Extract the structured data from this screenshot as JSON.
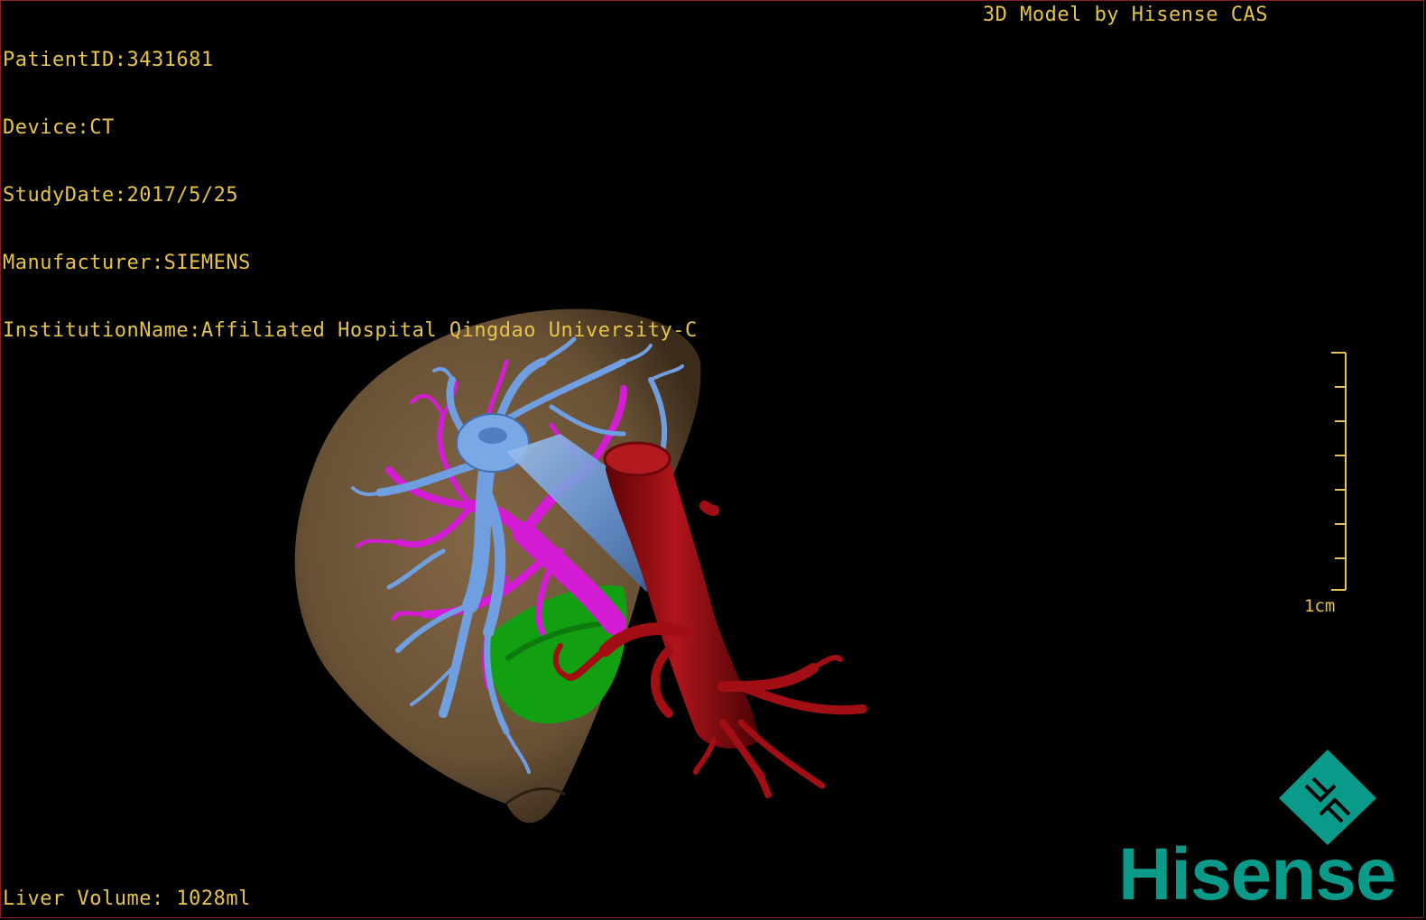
{
  "header": {
    "patient_id": "PatientID:3431681",
    "device": "Device:CT",
    "study_date": "StudyDate:2017/5/25",
    "manufacturer": "Manufacturer:SIEMENS",
    "institution": "InstitutionName:Affiliated Hospital Qingdao University-C"
  },
  "brand": {
    "caption": "3D Model by Hisense CAS",
    "logo_text": "Hisense",
    "logo_color": "#0a9a8a"
  },
  "footer": {
    "liver_volume": "Liver Volume: 1028ml"
  },
  "scale": {
    "label": "1cm",
    "color": "#e6c44a"
  },
  "model": {
    "structures": [
      {
        "name": "liver",
        "color": "#7a6040"
      },
      {
        "name": "hepatic-veins",
        "color": "#6f9fe0"
      },
      {
        "name": "portal-veins",
        "color": "#d41cd4"
      },
      {
        "name": "inferior-vena-cava-aorta",
        "color": "#a10e14"
      },
      {
        "name": "gallbladder",
        "color": "#14a814"
      }
    ]
  }
}
